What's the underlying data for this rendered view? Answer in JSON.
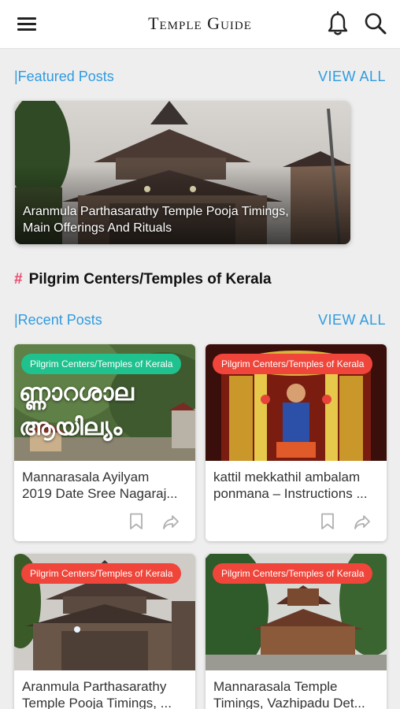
{
  "app": {
    "title": "Temple Guide"
  },
  "icons": {
    "menu": "hamburger-menu-icon",
    "notifications": "bell-icon",
    "search": "search-icon",
    "bookmark": "bookmark-icon",
    "share": "share-icon"
  },
  "colors": {
    "accent": "#2f9be0",
    "hash": "#e8486c",
    "badge_teal": "#1fc28f",
    "badge_red": "#f0453a"
  },
  "featured": {
    "label": "|Featured Posts",
    "view_all": "VIEW ALL",
    "post": {
      "title": "Aranmula Parthasarathy Temple Pooja Timings, Main Offerings And Rituals"
    }
  },
  "category": {
    "hash": "#",
    "name": "Pilgrim Centers/Temples of Kerala"
  },
  "recent": {
    "label": "|Recent Posts",
    "view_all": "VIEW ALL",
    "posts": [
      {
        "badge": "Pilgrim Centers/Temples of Kerala",
        "line1": "Mannarasala Ayilyam",
        "line2": "2019 Date Sree Nagaraj...",
        "image_text": "ണ്ണാറശാല ആയില്യം"
      },
      {
        "badge": "Pilgrim Centers/Temples of Kerala",
        "line1": "kattil mekkathil ambalam",
        "line2": "ponmana – Instructions ..."
      },
      {
        "badge": "Pilgrim Centers/Temples of Kerala",
        "line1": "Aranmula Parthasarathy",
        "line2": "Temple Pooja Timings, ..."
      },
      {
        "badge": "Pilgrim Centers/Temples of Kerala",
        "line1": "Mannarasala Temple",
        "line2": "Timings, Vazhipadu Det..."
      }
    ]
  }
}
